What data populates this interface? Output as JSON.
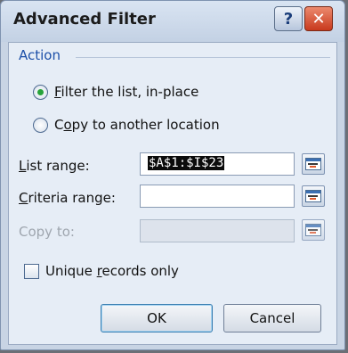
{
  "window": {
    "title": "Advanced Filter",
    "help_label": "?",
    "close_label": "✕"
  },
  "action": {
    "group_label": "Action",
    "options": [
      {
        "mnemonic": "F",
        "rest": "ilter the list, in-place",
        "selected": true
      },
      {
        "prefix": "C",
        "mnemonic": "o",
        "rest": "py to another location",
        "selected": false
      }
    ]
  },
  "fields": {
    "list_range": {
      "label_mnemonic": "L",
      "label_rest": "ist range:",
      "value": "$A$1:$I$23"
    },
    "criteria_range": {
      "label_mnemonic": "C",
      "label_rest": "riteria range:",
      "value": ""
    },
    "copy_to": {
      "label": "Copy to:",
      "value": "",
      "enabled": false
    }
  },
  "unique": {
    "prefix": "Unique ",
    "mnemonic": "r",
    "rest": "ecords only",
    "checked": false
  },
  "buttons": {
    "ok": "OK",
    "cancel": "Cancel"
  },
  "colors": {
    "accent": "#1c4fa8",
    "selected_dot": "#27a33a",
    "close": "#c8391d"
  },
  "icons": {
    "collapse": "collapse-dialog-icon",
    "help": "help-icon",
    "close": "close-icon"
  }
}
